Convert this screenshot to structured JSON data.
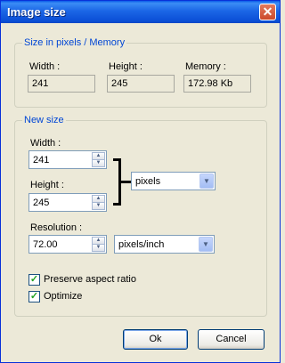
{
  "window": {
    "title": "Image size"
  },
  "size_group": {
    "legend": "Size in pixels / Memory",
    "width_label": "Width :",
    "width_value": "241",
    "height_label": "Height :",
    "height_value": "245",
    "memory_label": "Memory :",
    "memory_value": "172.98 Kb"
  },
  "new_size_group": {
    "legend": "New size",
    "width_label": "Width :",
    "width_value": "241",
    "height_label": "Height :",
    "height_value": "245",
    "unit_value": "pixels",
    "resolution_label": "Resolution :",
    "resolution_value": "72.00",
    "resolution_unit_value": "pixels/inch",
    "preserve_label": "Preserve aspect ratio",
    "preserve_checked": true,
    "optimize_label": "Optimize",
    "optimize_checked": true
  },
  "buttons": {
    "ok": "Ok",
    "cancel": "Cancel"
  },
  "icons": {
    "close": "close-icon",
    "spin_up": "spin-up-icon",
    "spin_down": "spin-down-icon",
    "dropdown": "chevron-down-icon",
    "check": "checkmark-icon"
  }
}
